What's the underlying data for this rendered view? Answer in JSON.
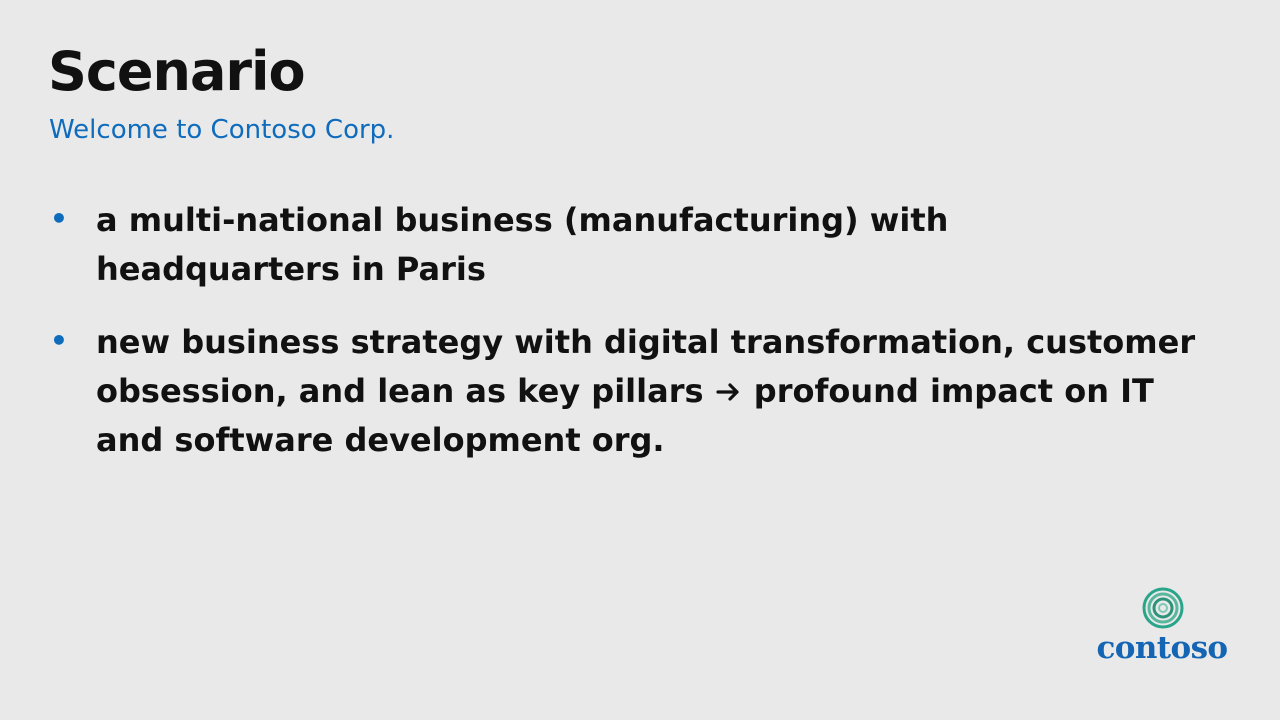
{
  "slide": {
    "title": "Scenario",
    "subtitle": "Welcome to Contoso Corp.",
    "bullets": [
      {
        "text": "a multi-national business (manufacturing) with headquarters in Paris"
      },
      {
        "text_before": "new business strategy with digital transformation, customer obsession, and lean as key pillars",
        "arrow_icon": "right-arrow-icon",
        "text_after": "profound impact on IT and software development org."
      }
    ],
    "logo": {
      "icon": "contoso-rings-icon",
      "text": "contoso"
    }
  },
  "colors": {
    "background": "#e9e9e9",
    "title": "#111111",
    "accent": "#0f6cbd",
    "logo_text": "#1465b4",
    "logo_ring": "#2aa58b"
  }
}
